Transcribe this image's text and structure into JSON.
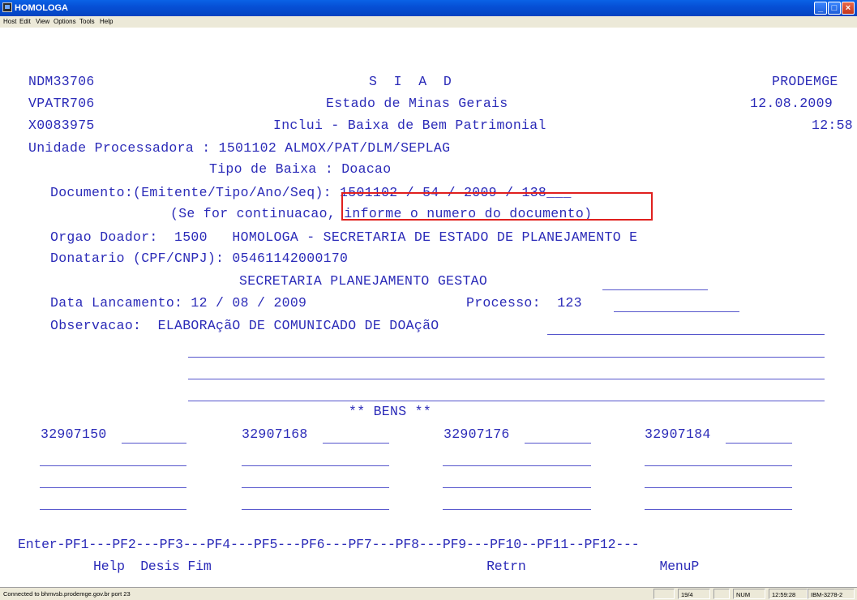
{
  "window": {
    "title": "HOMOLOGA",
    "minimize": "_",
    "maximize": "□",
    "close": "×"
  },
  "menu": [
    "Host",
    "Edit",
    "View",
    "Options",
    "Tools",
    "Help"
  ],
  "screen": {
    "row1_left": "NDM33706",
    "row1_center": "S  I  A  D",
    "row1_right": "PRODEMGE",
    "row2_left": "VPATR706",
    "row2_center": "Estado de Minas Gerais",
    "row2_right": "12.08.2009",
    "row3_left": "X0083975",
    "row3_center": "Inclui - Baixa de Bem Patrimonial",
    "row3_right": "12:58",
    "unidade": "Unidade Processadora : 1501102 ALMOX/PAT/DLM/SEPLAG",
    "tipo_baixa": "Tipo de Baixa : Doacao",
    "documento": "Documento:(Emitente/Tipo/Ano/Seq): 1501102 / 54 / 2009 / 138___",
    "continuacao": "(Se for continuacao, informe o numero do documento)",
    "orgao": "Orgao Doador:  1500   HOMOLOGA - SECRETARIA DE ESTADO DE PLANEJAMENTO E",
    "donatario": "Donatario (CPF/CNPJ): 05461142000170",
    "donatario_nome": "SECRETARIA PLANEJAMENTO GESTAO",
    "data_lancamento": "Data Lancamento: 12 / 08 / 2009",
    "processo": "Processo:  123",
    "observacao": "Observacao:  ELABORAçãO DE COMUNICADO DE DOAçãO",
    "bens_title": "** BENS **",
    "bens": [
      "32907150",
      "32907168",
      "32907176",
      "32907184"
    ],
    "pf_row": "Enter-PF1---PF2---PF3---PF4---PF5---PF6---PF7---PF8---PF9---PF10--PF11--PF12---",
    "pf_labels": "Help  Desis Fim                                   Retrn                 MenuP"
  },
  "status": {
    "connection": "Connected to bhmvsb.prodemge.gov.br port 23",
    "cursor": "19/4",
    "num": "NUM",
    "clock": "12:59:28",
    "terminal": "IBM-3278-2"
  },
  "colors": {
    "terminal_text": "#2b2bb8",
    "highlight": "#e0201e",
    "titlebar": "#0650d6"
  }
}
